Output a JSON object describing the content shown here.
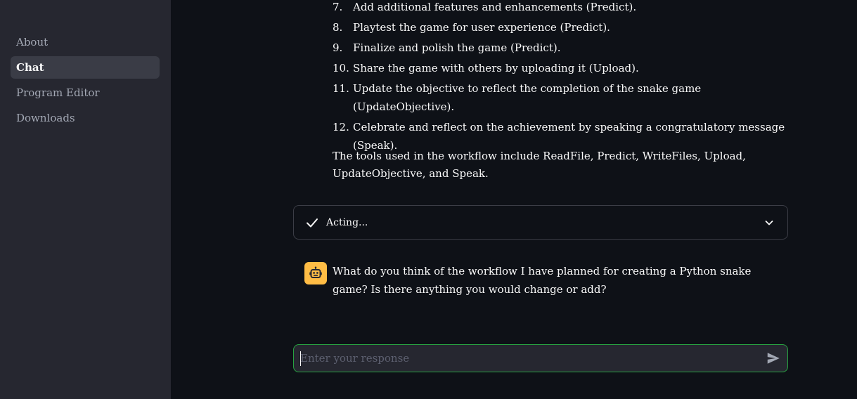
{
  "sidebar": {
    "items": [
      {
        "label": "About"
      },
      {
        "label": "Chat"
      },
      {
        "label": "Program Editor"
      },
      {
        "label": "Downloads"
      }
    ],
    "active_index": 1
  },
  "chat": {
    "steps": [
      {
        "num": "7.",
        "text": "Add additional features and enhancements (Predict)."
      },
      {
        "num": "8.",
        "text": "Playtest the game for user experience (Predict)."
      },
      {
        "num": "9.",
        "text": "Finalize and polish the game (Predict)."
      },
      {
        "num": "10.",
        "text": "Share the game with others by uploading it (Upload)."
      },
      {
        "num": "11.",
        "text": "Update the objective to reflect the completion of the snake game (UpdateObjective)."
      },
      {
        "num": "12.",
        "text": "Celebrate and reflect on the achievement by speaking a congratulatory message (Speak)."
      }
    ],
    "summary": "The tools used in the workflow include ReadFile, Predict, WriteFiles, Upload, UpdateObjective, and Speak.",
    "status_expander": {
      "label": "Acting...",
      "icon": "check-icon"
    },
    "assistant_message": "What do you think of the workflow I have planned for creating a Python snake game? Is there anything you would change or add?"
  },
  "input": {
    "placeholder": "Enter your response",
    "value": ""
  },
  "colors": {
    "background": "#0e1117",
    "sidebar": "#262730",
    "avatar": "#ffbd45",
    "input_border_focus": "#27a341"
  }
}
